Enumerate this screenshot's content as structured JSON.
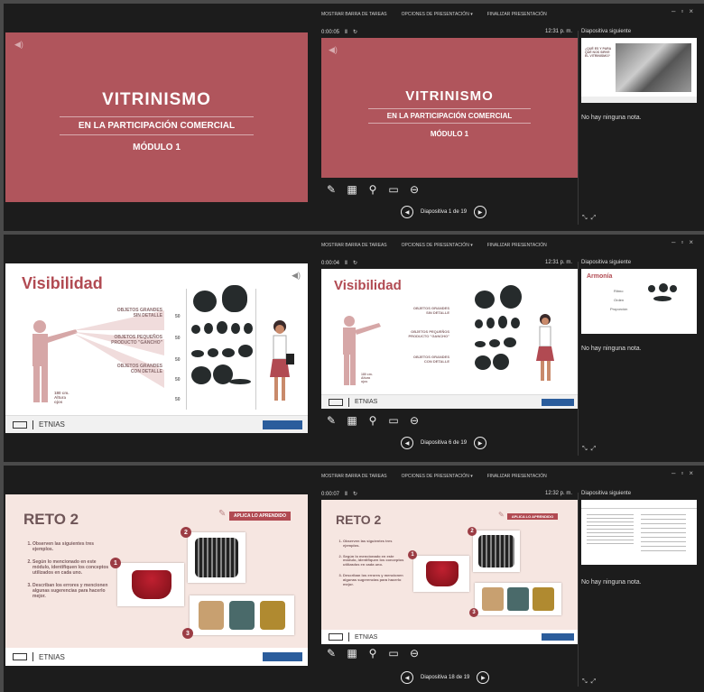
{
  "topbar": {
    "show_taskbar": "Mostrar barra de tareas",
    "options": "Opciones de presentación ▾",
    "end": "Finalizar presentación"
  },
  "panels": [
    {
      "timer": "0:00:05",
      "clock": "12:31 p. m.",
      "next_label": "Diapositiva siguiente",
      "notes": "No hay ninguna nota.",
      "counter": "Diapositiva 1 de 19"
    },
    {
      "timer": "0:00:04",
      "clock": "12:31 p. m.",
      "next_label": "Diapositiva siguiente",
      "notes": "No hay ninguna nota.",
      "counter": "Diapositiva 6 de 19"
    },
    {
      "timer": "0:00:07",
      "clock": "12:32 p. m.",
      "next_label": "Diapositiva siguiente",
      "notes": "No hay ninguna nota.",
      "counter": "Diapositiva 18 de 19"
    }
  ],
  "slide1": {
    "title": "VITRINISMO",
    "subtitle": "EN LA PARTICIPACIÓN COMERCIAL",
    "module": "MÓDULO 1"
  },
  "slide2": {
    "title": "Visibilidad",
    "row1": "OBJETOS GRANDES\nSIN DETALLE",
    "row2": "OBJETOS PEQUEÑOS\nPRODUCTO \"GANCHO\"",
    "row3": "OBJETOS GRANDES\nCON DETALLE",
    "height": "180 cm.\nAltura\nojos",
    "shelf": "50",
    "footer": "ETNIAS"
  },
  "slide3": {
    "title": "RETO 2",
    "badge": "APLICA LO APRENDIDO",
    "items": [
      "Observen las siguientes tres ejemplos.",
      "Según lo mencionado en este módulo, identifiquen los conceptos utilizados en cada uno.",
      "Describan los errores y mencionen algunas sugerencias para hacerlo mejor."
    ],
    "footer": "ETNIAS"
  },
  "next1": {
    "text": "¿QUÉ ES Y PARA QUÉ NOS SIRVE EL VITRINISMO?"
  },
  "next2": {
    "title": "Armonía",
    "items": [
      "Ritmo",
      "Orden",
      "Proporción"
    ]
  },
  "icons": {
    "pen": "pen-icon",
    "grid": "grid-icon",
    "search": "search-icon",
    "screen": "screen-icon",
    "more": "more-icon"
  },
  "colors": {
    "accent": "#b14a52",
    "rose": "#b0555c",
    "dark": "#1c1c1c"
  }
}
